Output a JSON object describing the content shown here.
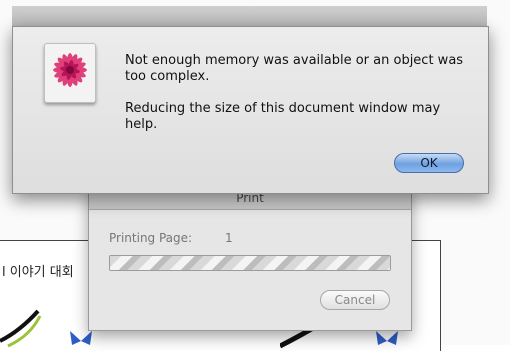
{
  "alert": {
    "message": "Not enough memory was available or an object was too complex.",
    "informative": "Reducing the size of this document window may help.",
    "ok_label": "OK",
    "icon": "flower-app-icon"
  },
  "print_window": {
    "title": "Print",
    "status_label": "Printing Page:",
    "page_number": "1",
    "cancel_label": "Cancel"
  },
  "document": {
    "heading": "l 이야기 대회"
  },
  "colors": {
    "ok_button": "#6fa1e1",
    "flower": "#e0407a"
  }
}
